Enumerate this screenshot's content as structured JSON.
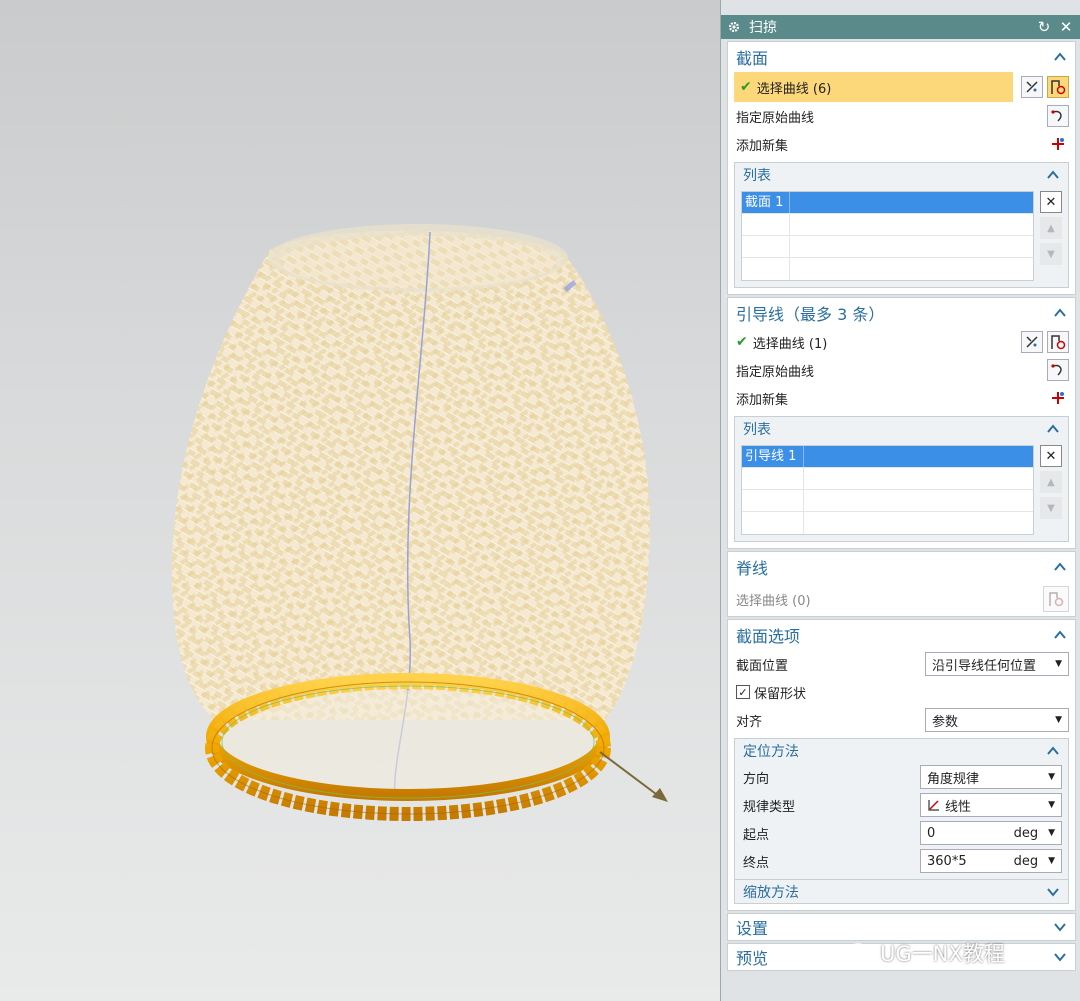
{
  "dialog": {
    "title": "扫掠"
  },
  "section_profile": {
    "title": "截面",
    "select_curve": "选择曲线 (6)",
    "specify_origin": "指定原始曲线",
    "add_new_set": "添加新集",
    "list_title": "列表",
    "list_items": [
      "截面 1"
    ]
  },
  "section_guide": {
    "title": "引导线（最多 3 条）",
    "select_curve": "选择曲线 (1)",
    "specify_origin": "指定原始曲线",
    "add_new_set": "添加新集",
    "list_title": "列表",
    "list_items": [
      "引导线 1"
    ]
  },
  "section_spine": {
    "title": "脊线",
    "select_curve": "选择曲线 (0)"
  },
  "section_options": {
    "title": "截面选项",
    "position_label": "截面位置",
    "position_value": "沿引导线任何位置",
    "preserve_shape": "保留形状",
    "preserve_checked": true,
    "align_label": "对齐",
    "align_value": "参数",
    "orientation": {
      "title": "定位方法",
      "direction_label": "方向",
      "direction_value": "角度规律",
      "law_type_label": "规律类型",
      "law_type_value": "线性",
      "start_label": "起点",
      "start_value": "0",
      "start_unit": "deg",
      "end_label": "终点",
      "end_value": "360*5",
      "end_unit": "deg"
    },
    "scaling_title": "缩放方法"
  },
  "section_settings": {
    "title": "设置"
  },
  "section_preview": {
    "title": "预览"
  },
  "watermark": "UG一NX教程",
  "colors": {
    "titlebar": "#5b8a8a",
    "accent_text": "#2b6f9e",
    "selection_highlight": "#fcd87a",
    "list_selected": "#3b8fe6",
    "rope": "#f0a800",
    "basket": "#eedcb0"
  }
}
